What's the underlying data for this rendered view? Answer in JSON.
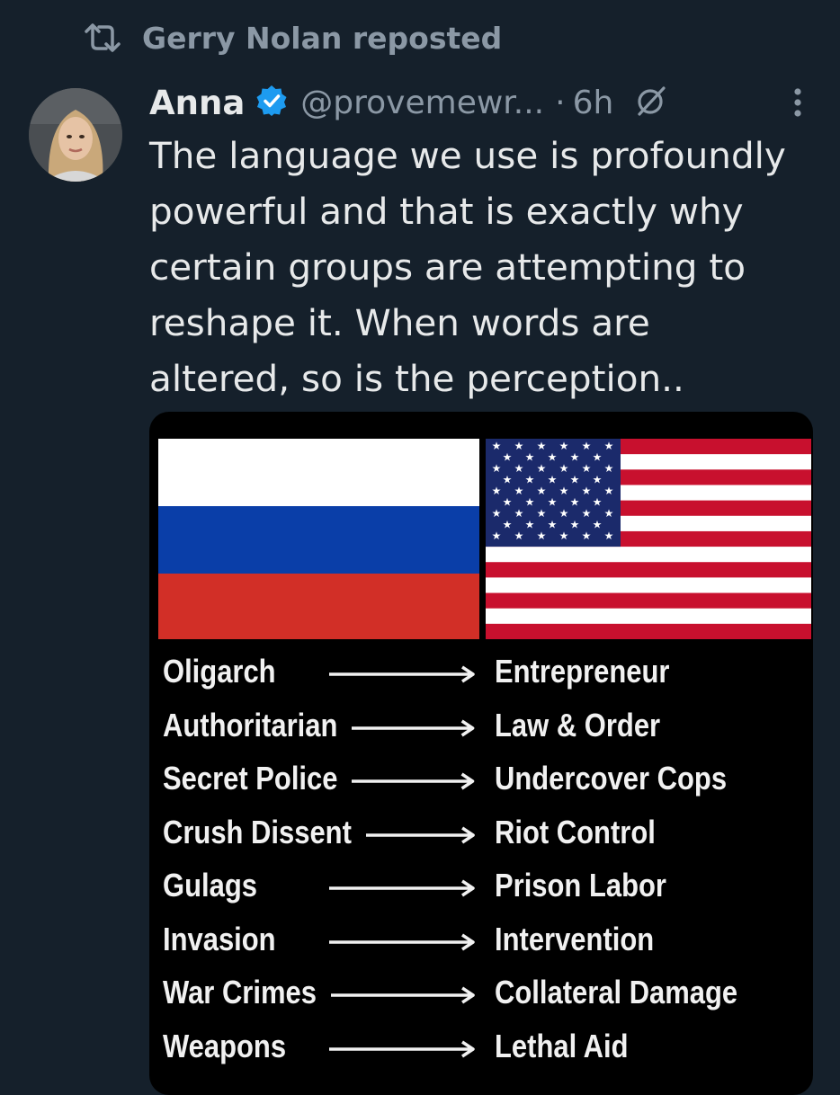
{
  "repost": {
    "label": "Gerry Nolan reposted",
    "icon": "repost-icon"
  },
  "tweet": {
    "display_name": "Anna",
    "handle": "@provemewr...",
    "dot": "·",
    "time": "6h",
    "text_lines": [
      "The language we use is profoundly",
      "powerful and that is exactly why",
      "certain groups are attempting to",
      "reshape it. When words are",
      "altered, so is the perception.."
    ]
  },
  "media": {
    "flags": [
      "russia-flag",
      "usa-flag"
    ],
    "pairs": [
      {
        "left": "Oligarch",
        "right": "Entrepreneur"
      },
      {
        "left": "Authoritarian",
        "right": "Law & Order"
      },
      {
        "left": "Secret Police",
        "right": "Undercover Cops"
      },
      {
        "left": "Crush Dissent",
        "right": "Riot Control"
      },
      {
        "left": "Gulags",
        "right": "Prison Labor"
      },
      {
        "left": "Invasion",
        "right": "Intervention"
      },
      {
        "left": "War Crimes",
        "right": "Collateral Damage"
      },
      {
        "left": "Weapons",
        "right": "Lethal Aid"
      }
    ]
  },
  "colors": {
    "background": "#15202b",
    "text": "#e7e9ea",
    "muted": "#8b98a5",
    "verified": "#1d9bf0",
    "ru_white": "#ffffff",
    "ru_blue": "#0a3ea8",
    "ru_red": "#d22f27",
    "us_red": "#c8102e",
    "us_blue": "#1b2a6b"
  }
}
